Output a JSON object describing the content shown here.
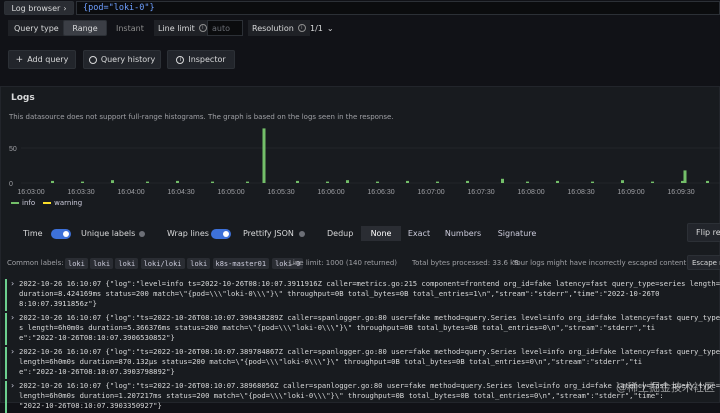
{
  "header": {
    "datasource_label": "Log browser",
    "query": "{pod=\"loki-0\"}"
  },
  "options": {
    "query_type_label": "Query type",
    "query_type_options": [
      "Range",
      "Instant"
    ],
    "query_type_selected": "Range",
    "line_limit_label": "Line limit",
    "line_limit_placeholder": "auto",
    "resolution_label": "Resolution",
    "resolution_value": "1/1"
  },
  "toolbar": {
    "add_query": "Add query",
    "query_history": "Query history",
    "inspector": "Inspector"
  },
  "logs_panel": {
    "title": "Logs",
    "notice": "This datasource does not support full-range histograms. The graph is based on the logs seen in the response."
  },
  "histogram": {
    "y_ticks": [
      "50",
      "0"
    ],
    "x_ticks": [
      "16:03:00",
      "16:03:30",
      "16:04:00",
      "16:04:30",
      "16:05:00",
      "16:05:30",
      "16:06:00",
      "16:06:30",
      "16:07:00",
      "16:07:30",
      "16:08:00",
      "16:08:30",
      "16:09:00",
      "16:09:30"
    ],
    "legend": [
      {
        "name": "info",
        "color": "#73bf69"
      },
      {
        "name": "warning",
        "color": "#fade2a"
      }
    ],
    "bars": [
      {
        "t": 0.4,
        "v": 3,
        "level": "info"
      },
      {
        "t": 1.0,
        "v": 2,
        "level": "info"
      },
      {
        "t": 1.6,
        "v": 4,
        "level": "info"
      },
      {
        "t": 2.3,
        "v": 2,
        "level": "info"
      },
      {
        "t": 2.9,
        "v": 3,
        "level": "info"
      },
      {
        "t": 3.6,
        "v": 2,
        "level": "info"
      },
      {
        "t": 4.3,
        "v": 2,
        "level": "info"
      },
      {
        "t": 4.63,
        "v": 78,
        "level": "info"
      },
      {
        "t": 5.3,
        "v": 3,
        "level": "info"
      },
      {
        "t": 5.9,
        "v": 2,
        "level": "info"
      },
      {
        "t": 6.3,
        "v": 4,
        "level": "info"
      },
      {
        "t": 6.9,
        "v": 2,
        "level": "info"
      },
      {
        "t": 7.5,
        "v": 3,
        "level": "info"
      },
      {
        "t": 8.1,
        "v": 2,
        "level": "info"
      },
      {
        "t": 8.7,
        "v": 3,
        "level": "info"
      },
      {
        "t": 9.4,
        "v": 6,
        "level": "info"
      },
      {
        "t": 9.9,
        "v": 2,
        "level": "info"
      },
      {
        "t": 10.5,
        "v": 3,
        "level": "info"
      },
      {
        "t": 11.2,
        "v": 2,
        "level": "info"
      },
      {
        "t": 11.8,
        "v": 4,
        "level": "info"
      },
      {
        "t": 12.4,
        "v": 2,
        "level": "info"
      },
      {
        "t": 13.0,
        "v": 3,
        "level": "info"
      },
      {
        "t": 13.05,
        "v": 18,
        "level": "info"
      },
      {
        "t": 13.5,
        "v": 3,
        "level": "info"
      }
    ]
  },
  "controls": {
    "time": "Time",
    "unique_labels": "Unique labels",
    "wrap_lines": "Wrap lines",
    "prettify_json": "Prettify JSON",
    "dedup": "Dedup",
    "dedup_options": [
      "None",
      "Exact",
      "Numbers",
      "Signature"
    ],
    "flip": "Flip re"
  },
  "stats": {
    "common_labels_label": "Common labels:",
    "common_labels": [
      "loki",
      "loki",
      "loki",
      "loki/loki",
      "loki",
      "k8s-master01",
      "loki-0"
    ],
    "line_limit": "Line limit: 1000 (140 returned)",
    "total_bytes": "Total bytes processed: 33.6 kB",
    "warning": "Your logs might have incorrectly escaped content:",
    "escape": "Escape n"
  },
  "logs": [
    {
      "time": "2022-10-26 16:10:07",
      "lines": [
        "{\"log\":\"level=info ts=2022-10-26T08:10:07.3911916Z caller=metrics.go:215 component=frontend org_id=fake latency=fast query_type=series length=6h0m",
        "duration=8.424169ms status=200 match=\\\"{pod=\\\\\\\"loki-0\\\\\\\"}\\\" throughput=0B total_bytes=0B total_entries=1\\n\",\"stream\":\"stderr\",\"time\":\"2022-10-26T0",
        "8:10:07.3911856z\"}"
      ]
    },
    {
      "time": "2022-10-26 16:10:07",
      "lines": [
        "{\"log\":\"ts=2022-10-26T08:10:07.390438289Z caller=spanlogger.go:80 user=fake method=query.Series level=info org_id=fake latency=fast query_type=ser",
        "s length=6h0m0s duration=5.366376ms status=200 match=\\\"{pod=\\\\\\\"loki-0\\\\\\\"}\\\" throughput=0B total_bytes=0B total_entries=0\\n\",\"stream\":\"stderr\",\"ti",
        "e\":\"2022-10-26T08:10:07.3906530852\"}"
      ]
    },
    {
      "time": "2022-10-26 16:10:07",
      "lines": [
        "{\"log\":\"ts=2022-10-26T08:10:07.389784867Z caller=spanlogger.go:80 user=fake method=query.Series level=info org_id=fake latency=fast query_type=ser",
        "length=6h0m0s duration=870.132µs status=200 match=\\\"{pod=\\\\\\\"loki-0\\\\\\\"}\\\" throughput=0B total_bytes=0B total_entries=0\\n\",\"stream\":\"stderr\",\"ti",
        "e\":\"2022-10-26T08:10:07.3903798892\"}"
      ]
    },
    {
      "time": "2022-10-26 16:10:07",
      "lines": [
        "{\"log\":\"ts=2022-10-26T08:10:07.38968056Z caller=spanlogger.go:80 user=fake method=query.Series level=info org_id=fake latency=fast query_type=series",
        "length=6h0m0s duration=1.207217ms status=200 match=\\\"{pod=\\\\\\\"loki-0\\\\\\\"}\\\" throughput=0B total_bytes=0B total_entries=0\\n\",\"stream\":\"stderr\",\"time\":",
        "\"2022-10-26T08:10:07.3903350927\"}"
      ]
    }
  ],
  "watermark": "@稀土掘金技术社区"
}
